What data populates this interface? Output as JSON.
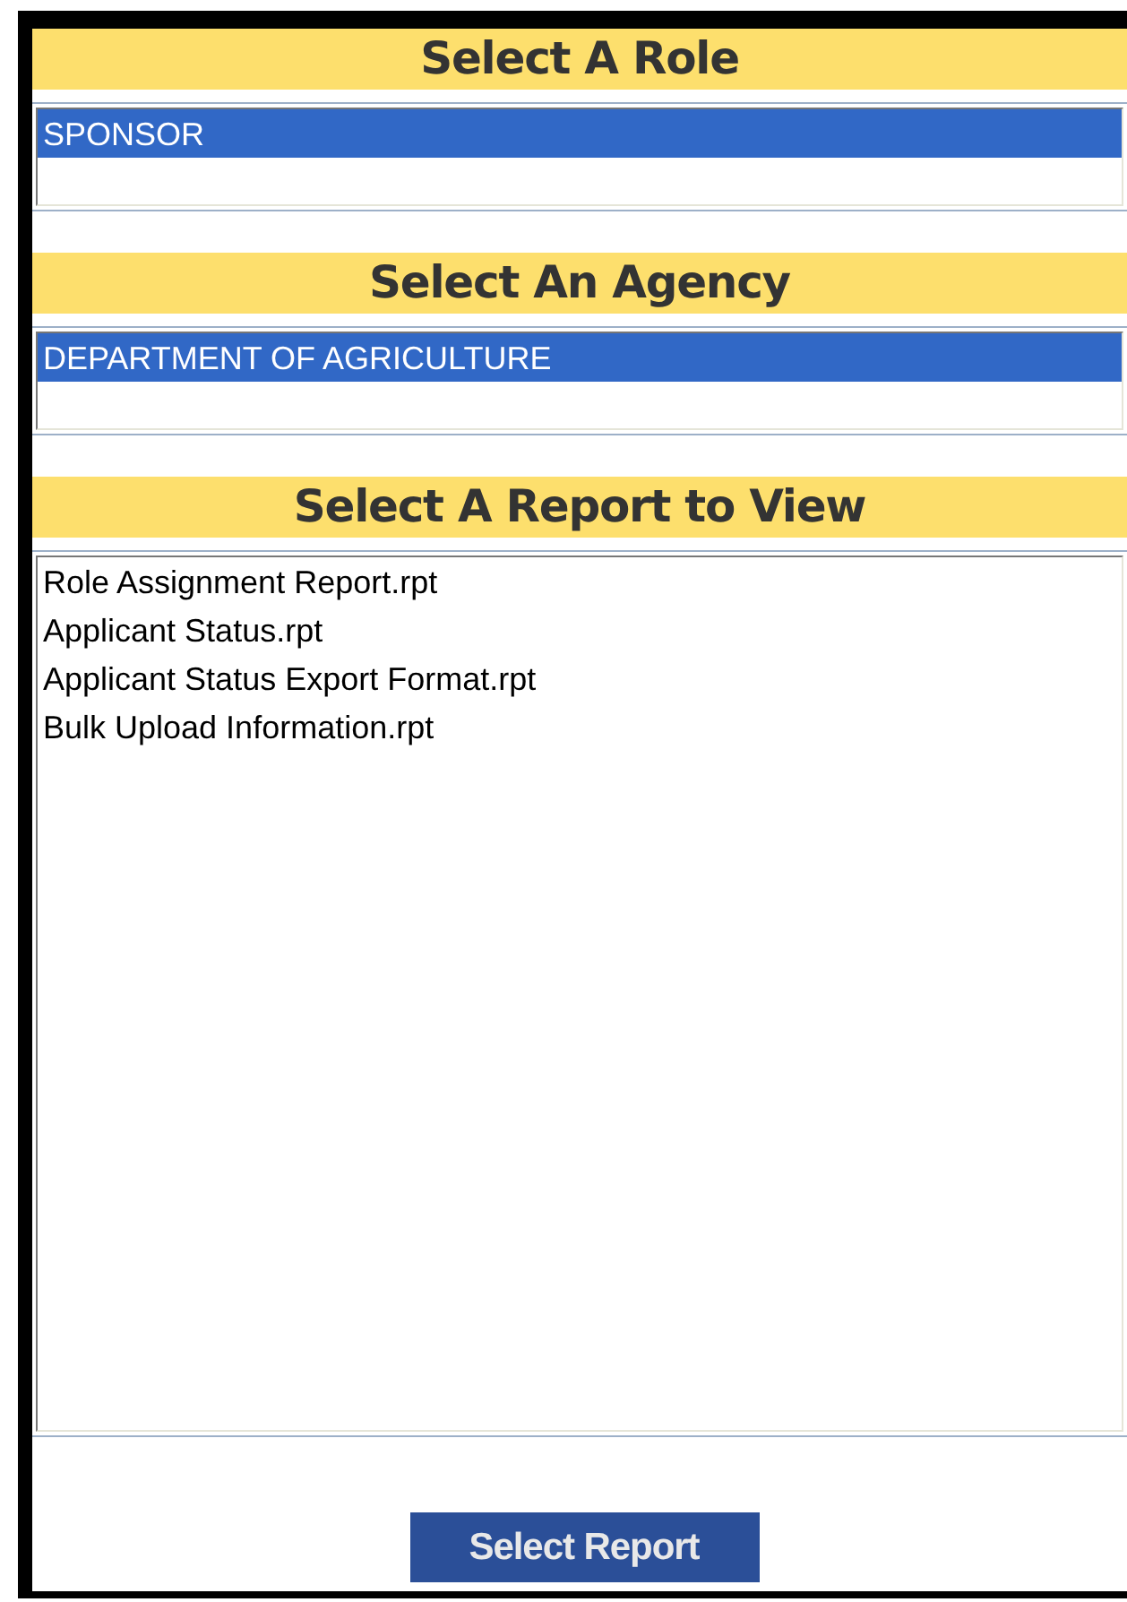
{
  "sections": [
    {
      "title": "Select A Role",
      "items": [
        {
          "label": "SPONSOR",
          "selected": true
        }
      ]
    },
    {
      "title": "Select An Agency",
      "items": [
        {
          "label": "DEPARTMENT OF AGRICULTURE",
          "selected": true
        }
      ]
    },
    {
      "title": "Select A Report to View",
      "items": [
        {
          "label": "Role Assignment Report.rpt",
          "selected": false
        },
        {
          "label": "Applicant Status.rpt",
          "selected": false
        },
        {
          "label": "Applicant Status Export Format.rpt",
          "selected": false
        },
        {
          "label": "Bulk Upload Information.rpt",
          "selected": false
        }
      ]
    }
  ],
  "button": "Select Report"
}
